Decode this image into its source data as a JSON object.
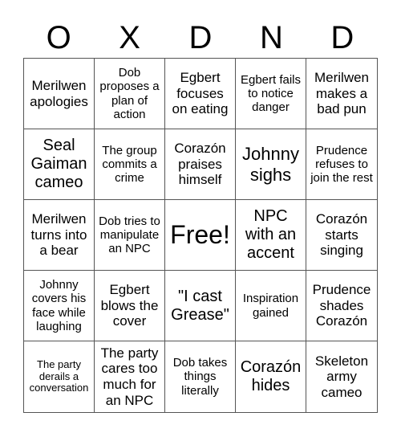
{
  "title_letters": [
    "O",
    "X",
    "D",
    "N",
    "D"
  ],
  "cells": [
    {
      "text": "Merilwen apologies",
      "size": "md"
    },
    {
      "text": "Dob proposes a plan of action",
      "size": "sm"
    },
    {
      "text": "Egbert focuses on eating",
      "size": "md"
    },
    {
      "text": "Egbert fails to notice danger",
      "size": "sm"
    },
    {
      "text": "Merilwen makes a bad pun",
      "size": "md"
    },
    {
      "text": "Seal Gaiman cameo",
      "size": "lg"
    },
    {
      "text": "The group commits a crime",
      "size": "sm"
    },
    {
      "text": "Corazón praises himself",
      "size": "md"
    },
    {
      "text": "Johnny sighs",
      "size": "xl"
    },
    {
      "text": "Prudence refuses to join the rest",
      "size": "sm"
    },
    {
      "text": "Merilwen turns into a bear",
      "size": "md"
    },
    {
      "text": "Dob tries to manipulate an NPC",
      "size": "sm"
    },
    {
      "text": "Free!",
      "size": "free"
    },
    {
      "text": "NPC with an accent",
      "size": "lg"
    },
    {
      "text": "Corazón starts singing",
      "size": "md"
    },
    {
      "text": "Johnny covers his face while laughing",
      "size": "sm"
    },
    {
      "text": "Egbert blows the cover",
      "size": "md"
    },
    {
      "text": "\"I cast Grease\"",
      "size": "lg"
    },
    {
      "text": "Inspiration gained",
      "size": "sm"
    },
    {
      "text": "Prudence shades Corazón",
      "size": "md"
    },
    {
      "text": "The party derails a conversation",
      "size": "xs"
    },
    {
      "text": "The party cares too much for an NPC",
      "size": "md"
    },
    {
      "text": "Dob takes things literally",
      "size": "sm"
    },
    {
      "text": "Corazón hides",
      "size": "lg"
    },
    {
      "text": "Skeleton army cameo",
      "size": "md"
    }
  ],
  "colors": {
    "grid_line": "#555555",
    "text": "#000000",
    "background": "#ffffff"
  }
}
